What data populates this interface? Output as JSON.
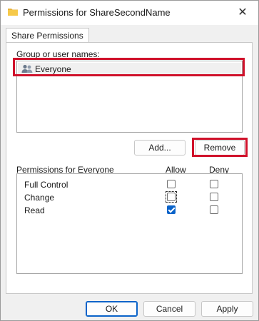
{
  "window": {
    "title": "Permissions for ShareSecondName",
    "close_glyph": "✕",
    "folder_color": "#e8b33a"
  },
  "tabs": [
    {
      "label": "Share Permissions"
    }
  ],
  "group_section": {
    "label": "Group or user names:",
    "items": [
      {
        "label": "Everyone",
        "icon": "users-icon",
        "selected": true
      }
    ]
  },
  "buttons": {
    "add_label": "Add...",
    "remove_label": "Remove"
  },
  "permissions": {
    "title": "Permissions for Everyone",
    "allow_header": "Allow",
    "deny_header": "Deny",
    "rows": [
      {
        "label": "Full Control",
        "allow": false,
        "deny": false
      },
      {
        "label": "Change",
        "allow": false,
        "deny": false
      },
      {
        "label": "Read",
        "allow": true,
        "deny": false
      }
    ]
  },
  "footer": {
    "ok_label": "OK",
    "cancel_label": "Cancel",
    "apply_label": "Apply"
  },
  "accent_color": "#0a63c9",
  "highlight_color": "#d0122b"
}
